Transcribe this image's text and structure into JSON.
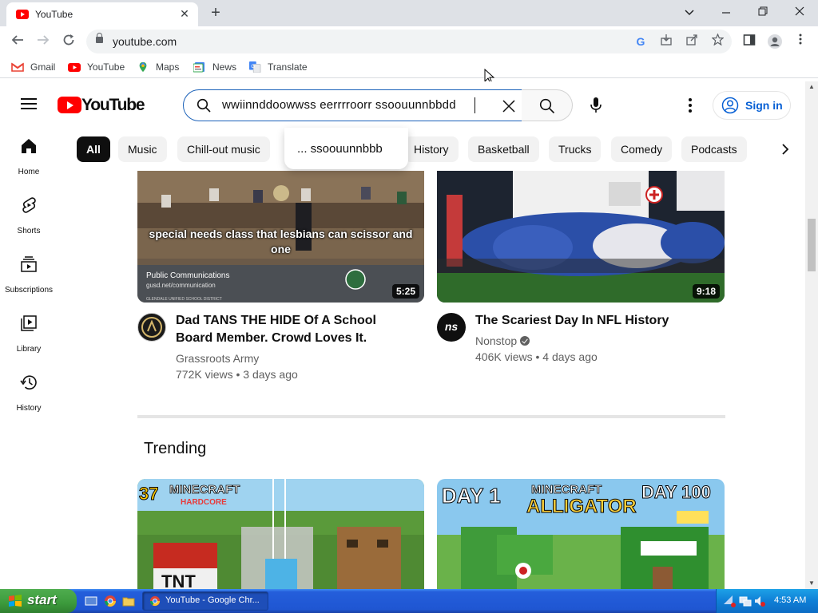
{
  "browser": {
    "tab_title": "YouTube",
    "tab_close": "✕",
    "new_tab": "+",
    "url": "youtube.com",
    "window_controls": [
      "chevron-down",
      "minimize",
      "restore",
      "close"
    ]
  },
  "bookmarks": [
    {
      "label": "Gmail",
      "icon": "gmail-icon"
    },
    {
      "label": "YouTube",
      "icon": "youtube-icon"
    },
    {
      "label": "Maps",
      "icon": "maps-icon"
    },
    {
      "label": "News",
      "icon": "news-icon"
    },
    {
      "label": "Translate",
      "icon": "translate-icon"
    }
  ],
  "masthead": {
    "logo_text": "YouTube",
    "search_query": "wwiinnddoowwss  eerrrroorr  ssoouunnbbdd",
    "sign_in": "Sign in"
  },
  "suggestion": "... ssoouunnbbb",
  "chips": [
    {
      "label": "All",
      "active": true
    },
    {
      "label": "Chill-out music",
      "active": false
    },
    {
      "label": "Music",
      "active": false
    },
    {
      "label": "History",
      "active": false
    },
    {
      "label": "Basketball",
      "active": false
    },
    {
      "label": "Trucks",
      "active": false
    },
    {
      "label": "Comedy",
      "active": false
    },
    {
      "label": "Podcasts",
      "active": false
    }
  ],
  "guide": [
    {
      "label": "Home",
      "icon": "home-icon"
    },
    {
      "label": "Shorts",
      "icon": "shorts-icon"
    },
    {
      "label": "Subscriptions",
      "icon": "subscriptions-icon"
    },
    {
      "label": "Library",
      "icon": "library-icon"
    },
    {
      "label": "History",
      "icon": "history-icon"
    }
  ],
  "videos": [
    {
      "title": "Dad TANS THE HIDE Of A School Board Member. Crowd Loves It.",
      "channel": "Grassroots Army",
      "verified": false,
      "meta": "772K views • 3 days ago",
      "duration": "5:25",
      "caption": "special needs class that lesbians can scissor and one",
      "overlay_title": "Public Communications",
      "overlay_sub": "gusd.net/communication",
      "overlay_footer": "GLENDALE UNIFIED SCHOOL DISTRICT"
    },
    {
      "title": "The Scariest Day In NFL History",
      "channel": "Nonstop",
      "verified": true,
      "meta": "406K views • 4 days ago",
      "duration": "9:18",
      "avatar_text": "ns"
    }
  ],
  "trending": {
    "heading": "Trending",
    "thumbs": [
      {
        "text1": "37",
        "text2": "MINECRAFT",
        "text3": "HARDCORE",
        "text4": "TNT"
      },
      {
        "text1": "DAY 1",
        "text2": "MINECRAFT",
        "text3": "ALLIGATOR",
        "text4": "DAY 100"
      }
    ]
  },
  "taskbar": {
    "start": "start",
    "task": "YouTube - Google Chr...",
    "clock": "4:53 AM"
  },
  "colors": {
    "yt_red": "#ff0000",
    "link_blue": "#065fd4",
    "xp_blue": "#245edb",
    "xp_green": "#3c9a3c"
  }
}
